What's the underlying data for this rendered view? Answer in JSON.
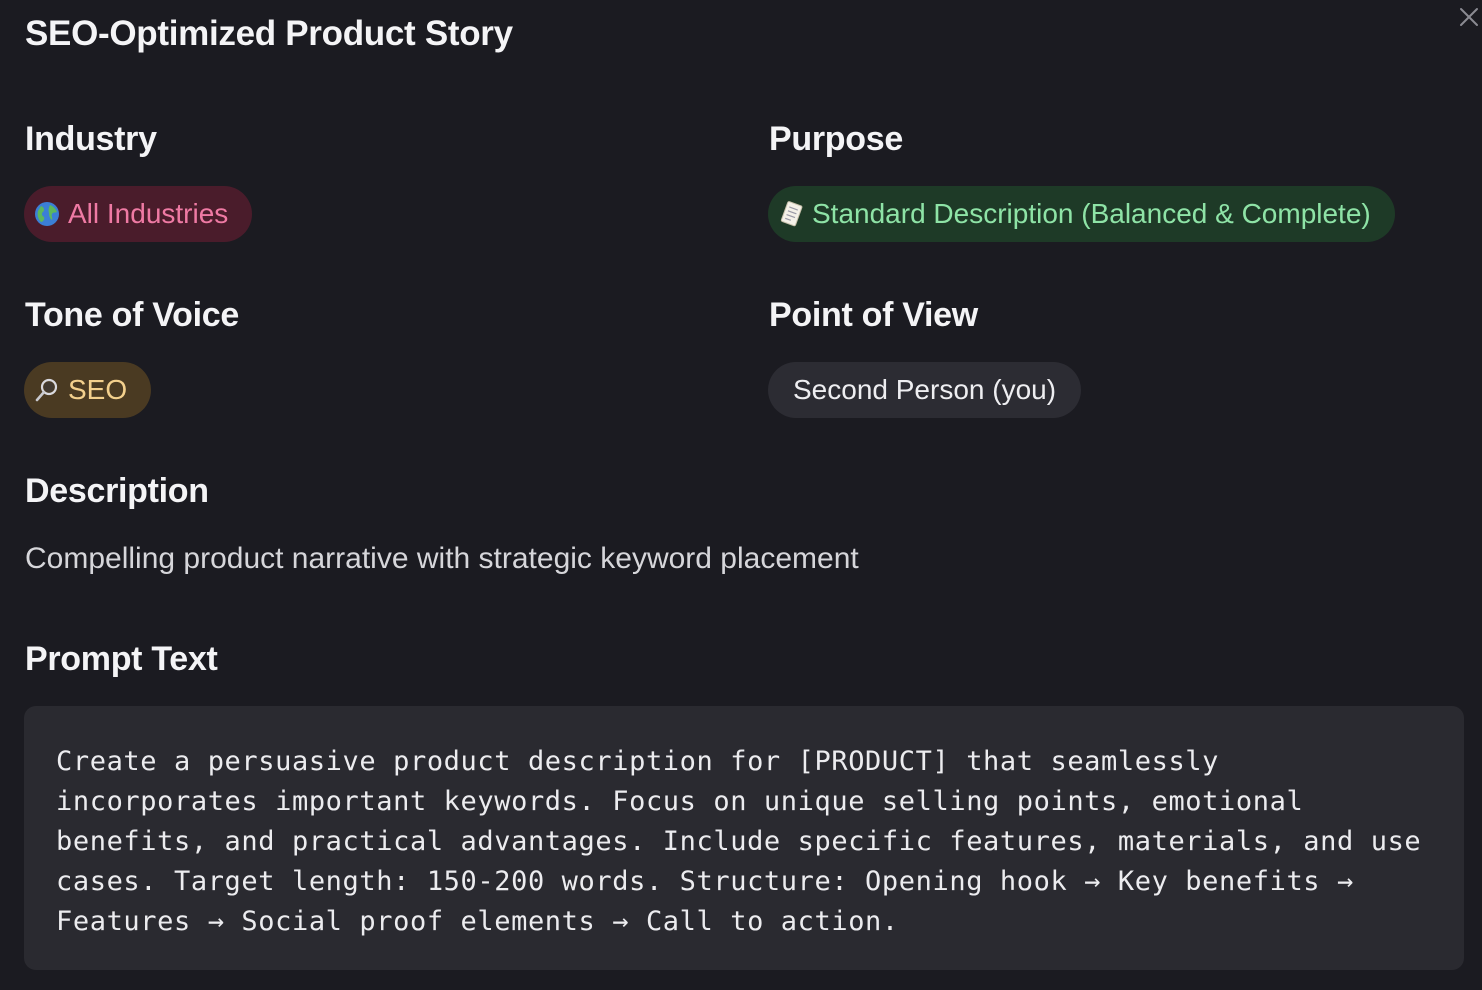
{
  "dialog": {
    "title": "SEO-Optimized Product Story",
    "close_icon": "close-icon"
  },
  "industry": {
    "label": "Industry",
    "chip_icon": "globe-icon",
    "chip_text": "All Industries",
    "chip_bg": "#4a1c2b",
    "chip_color": "#ef7aa4"
  },
  "purpose": {
    "label": "Purpose",
    "chip_icon": "memo-icon",
    "chip_text": "Standard Description (Balanced & Complete)",
    "chip_bg": "#1e3a27",
    "chip_color": "#8ee3a6"
  },
  "tone": {
    "label": "Tone of Voice",
    "chip_icon": "magnifier-icon",
    "chip_text": "SEO",
    "chip_bg": "#4a3a22",
    "chip_color": "#f3d08d"
  },
  "point_of_view": {
    "label": "Point of View",
    "chip_text": "Second Person (you)"
  },
  "description": {
    "label": "Description",
    "text": "Compelling product narrative with strategic keyword placement"
  },
  "prompt": {
    "label": "Prompt Text",
    "text": "Create a persuasive product description for [PRODUCT] that seamlessly incorporates important keywords. Focus on unique selling points, emotional benefits, and practical advantages. Include specific features, materials, and use cases. Target length: 150-200 words. Structure: Opening hook → Key benefits → Features → Social proof elements → Call to action."
  }
}
